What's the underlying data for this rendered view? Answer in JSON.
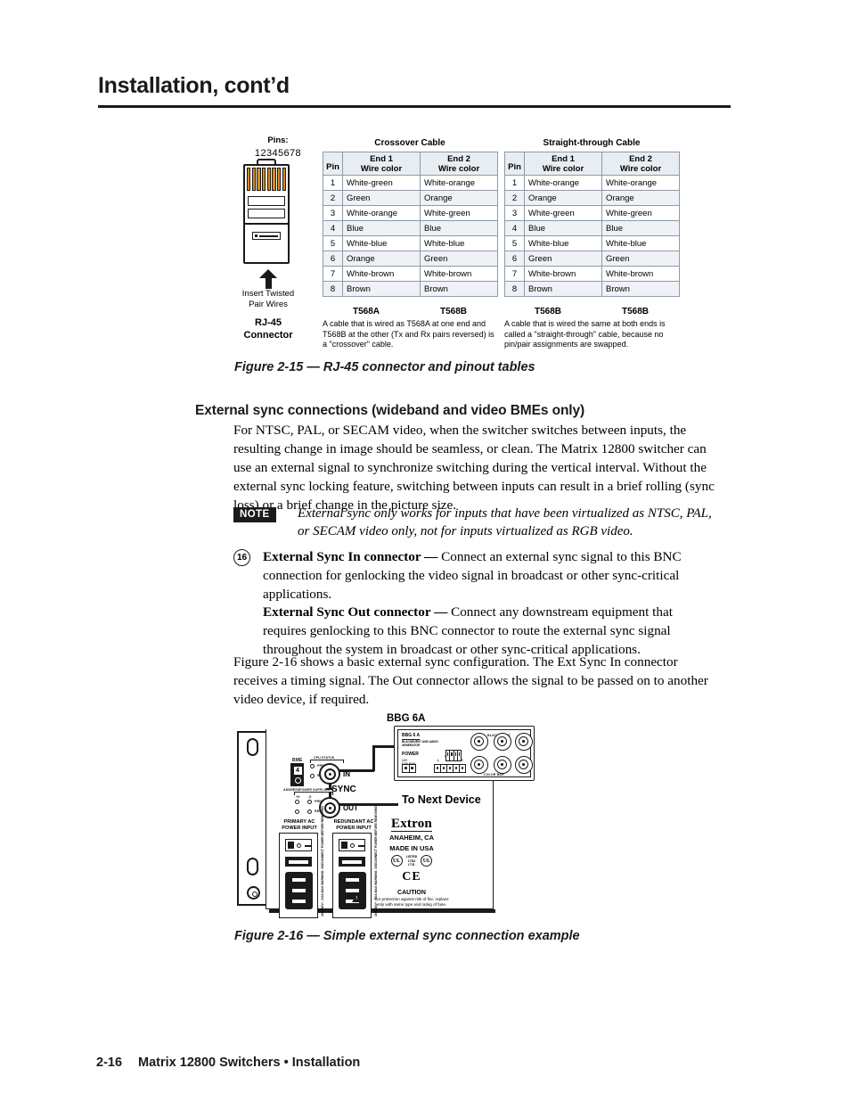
{
  "header": {
    "title": "Installation, cont’d"
  },
  "figure_2_15": {
    "pins_label": "Pins:",
    "pin_numbers": "12345678",
    "insert_text": "Insert Twisted\nPair Wires",
    "connector_caption": "RJ-45\nConnector",
    "caption": "Figure 2-15 — RJ-45 connector and pinout tables",
    "tables": [
      {
        "heading": "Crossover Cable",
        "columns": [
          "Pin",
          "End 1\nWire color",
          "End 2\nWire color"
        ],
        "col_pin": "Pin",
        "col_end1_line1": "End 1",
        "col_end1_line2": "Wire color",
        "col_end2_line1": "End 2",
        "col_end2_line2": "Wire color",
        "rows": [
          {
            "pin": "1",
            "end1": "White-green",
            "end2": "White-orange"
          },
          {
            "pin": "2",
            "end1": "Green",
            "end2": "Orange"
          },
          {
            "pin": "3",
            "end1": "White-orange",
            "end2": "White-green"
          },
          {
            "pin": "4",
            "end1": "Blue",
            "end2": "Blue"
          },
          {
            "pin": "5",
            "end1": "White-blue",
            "end2": "White-blue"
          },
          {
            "pin": "6",
            "end1": "Orange",
            "end2": "Green"
          },
          {
            "pin": "7",
            "end1": "White-brown",
            "end2": "White-brown"
          },
          {
            "pin": "8",
            "end1": "Brown",
            "end2": "Brown"
          }
        ],
        "standard_end1": "T568A",
        "standard_end2": "T568B",
        "note": "A cable that is wired as T568A at one end and T568B at the other (Tx and Rx pairs reversed) is a \"crossover\" cable."
      },
      {
        "heading": "Straight-through Cable",
        "columns": [
          "Pin",
          "End 1\nWire color",
          "End 2\nWire color"
        ],
        "col_pin": "Pin",
        "col_end1_line1": "End 1",
        "col_end1_line2": "Wire color",
        "col_end2_line1": "End 2",
        "col_end2_line2": "Wire color",
        "rows": [
          {
            "pin": "1",
            "end1": "White-orange",
            "end2": "White-orange"
          },
          {
            "pin": "2",
            "end1": "Orange",
            "end2": "Orange"
          },
          {
            "pin": "3",
            "end1": "White-green",
            "end2": "White-green"
          },
          {
            "pin": "4",
            "end1": "Blue",
            "end2": "Blue"
          },
          {
            "pin": "5",
            "end1": "White-blue",
            "end2": "White-blue"
          },
          {
            "pin": "6",
            "end1": "Green",
            "end2": "Green"
          },
          {
            "pin": "7",
            "end1": "White-brown",
            "end2": "White-brown"
          },
          {
            "pin": "8",
            "end1": "Brown",
            "end2": "Brown"
          }
        ],
        "standard_end1": "T568B",
        "standard_end2": "T568B",
        "note": "A cable that is wired the same at both ends is called a \"straight-through\" cable, because no pin/pair assignments are swapped."
      }
    ]
  },
  "section": {
    "heading": "External sync connections (wideband and video BMEs only)",
    "intro": "For NTSC, PAL, or SECAM video, when the switcher switches between inputs, the resulting change in image should be seamless, or clean.  The Matrix 12800 switcher can use an external signal to synchronize switching during the vertical interval.  Without the external sync locking feature, switching between inputs can result in a brief rolling (sync loss) or a brief change in the picture size.",
    "note_badge": "NOTE",
    "note_text": "External sync only works for inputs that have been virtualized as NTSC, PAL, or SECAM video only, not for inputs virtualized as RGB video.",
    "item_number": "16",
    "item_lead": "External Sync In connector —",
    "item_body": " Connect an external sync signal to this BNC connection for genlocking the video signal in broadcast or other sync-critical applications.",
    "out_lead": "External Sync Out connector —",
    "out_body": " Connect any downstream equipment that requires genlocking to this BNC connector to route the external sync signal throughout the system in broadcast or other sync-critical applications.",
    "fig16_intro": "Figure 2-16 shows a basic external sync configuration.  The Ext Sync In connector receives a timing signal.  The Out connector allows the signal to be passed on to another video device, if required."
  },
  "figure_2_16": {
    "caption": "Figure 2-16 — Simple external sync connection example",
    "bbg_title": "BBG 6A",
    "labels": {
      "sync": "SYNC",
      "in": "IN",
      "out": "OUT",
      "to_next_device": "To Next Device",
      "bme": "BME",
      "bme_value": "4",
      "address": "ADDRESS",
      "cpu_status": "CPU STATUS",
      "power_supplies": "POWER SUPPLIES",
      "primary": "PRIMARY",
      "redundant": "REDUNDANT",
      "plus5": "+5",
      "minus5": "-5",
      "primary_ac": "PRIMARY AC\nPOWER INPUT",
      "redundant_ac": "REDUNDANT AC\nPOWER INPUT",
      "fuse_text": "100-240V~, 5.0A MAX  WARNING: DISCONNECT POWER BEFORE REMOVING",
      "bbg_name": "BBG 6 A",
      "bbg_desc": "BLACKBURST AND AUDIO\nGENERATOR",
      "bbg_power": "POWER",
      "bbg_power_sub": "12V\n0.5A MAX",
      "bbg_audio": "1 KHZ\nAUDIO",
      "bbg_audio_l": "L",
      "bbg_audio_r": "R",
      "bbg_blackburst": "BLACKBURST",
      "bbg_colorbar": "COLOR BAR"
    },
    "brand": {
      "name": "Extron",
      "city": "ANAHEIM, CA",
      "made_in": "MADE IN USA",
      "ul_text": "LISTED\n17D2\nI.T.E.",
      "ul_glyph": "UL",
      "ce_mark": "CE",
      "caution_heading": "CAUTION",
      "caution_body": "For protection against risk of fire, replace only with same type and rating of fuse."
    }
  },
  "footer": {
    "page_number": "2-16",
    "text": "Matrix 12800 Switchers • Installation"
  }
}
